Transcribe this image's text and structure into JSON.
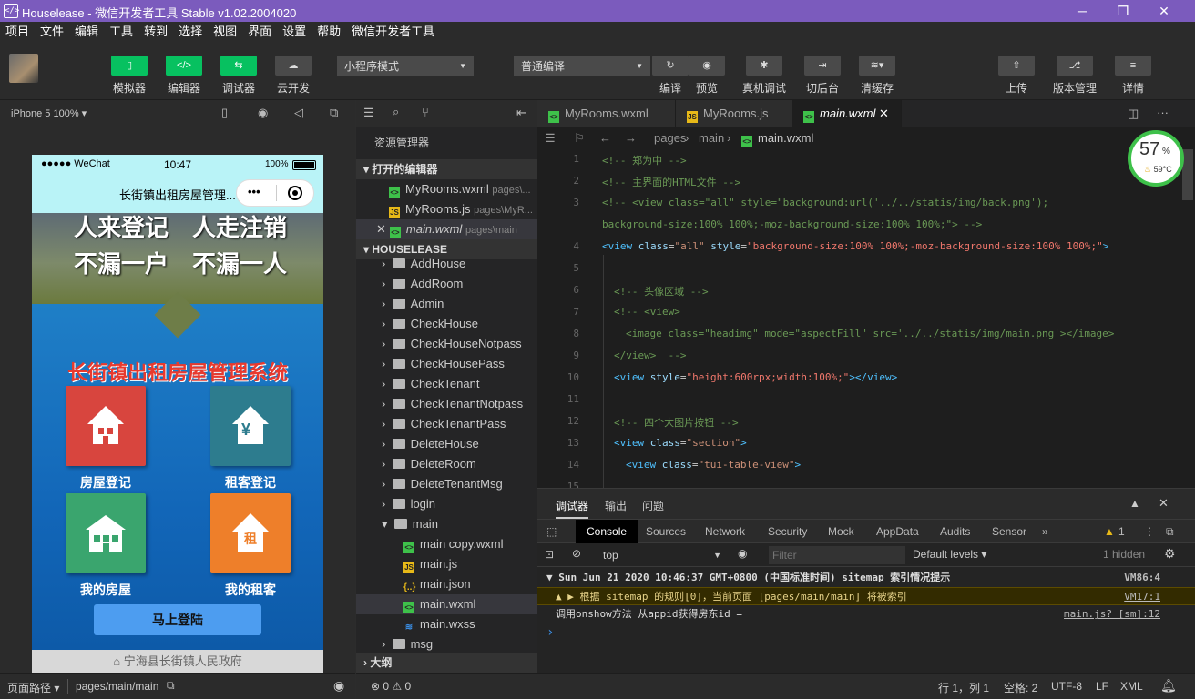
{
  "window": {
    "title": "Houselease - 微信开发者工具 Stable v1.02.2004020",
    "minimize": "─",
    "maximize": "❐",
    "close": "✕"
  },
  "menu": [
    "项目",
    "文件",
    "编辑",
    "工具",
    "转到",
    "选择",
    "视图",
    "界面",
    "设置",
    "帮助",
    "微信开发者工具"
  ],
  "toolbar": {
    "left_buttons": [
      {
        "label": "模拟器"
      },
      {
        "label": "编辑器"
      },
      {
        "label": "调试器"
      },
      {
        "label": "云开发"
      }
    ],
    "mode_select": "小程序模式",
    "compile_select": "普通编译",
    "compile_label": "编译",
    "preview_label": "预览",
    "remote_debug_label": "真机调试",
    "background_label": "切后台",
    "clear_cache_label": "清缓存",
    "upload_label": "上传",
    "version_label": "版本管理",
    "detail_label": "详情"
  },
  "simulator": {
    "device": "iPhone 5 100%",
    "status": {
      "signal": "●●●●● WeChat",
      "time": "10:47",
      "battery": "100%"
    },
    "nav_title": "长街镇出租房屋管理...",
    "hero_line1_a": "人来登记",
    "hero_line1_b": "人走注销",
    "hero_line2_a": "不漏一户",
    "hero_line2_b": "不漏一人",
    "system_title": "长街镇出租房屋管理系统",
    "tiles": [
      {
        "label": "房屋登记",
        "color": "#d8453e"
      },
      {
        "label": "租客登记",
        "color": "#2d7c8e"
      },
      {
        "label": "我的房屋",
        "color": "#3aa56e"
      },
      {
        "label": "我的租客",
        "color": "#ee7f2a"
      }
    ],
    "tile_rent_char": "租",
    "tile_yen_char": "¥",
    "login_button": "马上登陆",
    "footer_text": "宁海县长街镇人民政府",
    "path_label": "页面路径",
    "path_value": "pages/main/main"
  },
  "explorer": {
    "title": "资源管理器",
    "open_editors_label": "打开的编辑器",
    "open_editors": [
      {
        "name": "MyRooms.wxml",
        "path": "pages\\..."
      },
      {
        "name": "MyRooms.js",
        "path": "pages\\MyR..."
      },
      {
        "name": "main.wxml",
        "path": "pages\\main"
      }
    ],
    "project_label": "HOUSELEASE",
    "folders": [
      "AddHouse",
      "AddRoom",
      "Admin",
      "CheckHouse",
      "CheckHouseNotpass",
      "CheckHousePass",
      "CheckTenant",
      "CheckTenantNotpass",
      "CheckTenantPass",
      "DeleteHouse",
      "DeleteRoom",
      "DeleteTenantMsg",
      "login"
    ],
    "main_folder": "main",
    "main_files": [
      {
        "name": "main copy.wxml",
        "type": "wxml"
      },
      {
        "name": "main.js",
        "type": "js"
      },
      {
        "name": "main.json",
        "type": "json"
      },
      {
        "name": "main.wxml",
        "type": "wxml"
      },
      {
        "name": "main.wxss",
        "type": "wxss"
      }
    ],
    "msg_folder": "msg",
    "outline_label": "大纲",
    "problems": "⊗ 0 ⚠ 0"
  },
  "editor": {
    "tabs": [
      "MyRooms.wxml",
      "MyRooms.js",
      "main.wxml"
    ],
    "breadcrumb": [
      "pages",
      "main",
      "main.wxml"
    ],
    "gauge_percent": "57",
    "gauge_unit": "%",
    "gauge_temp": "59°C",
    "line_numbers": [
      "1",
      "2",
      "3",
      "",
      "4",
      "5",
      "6",
      "7",
      "8",
      "9",
      "10",
      "11",
      "12",
      "13",
      "14",
      "15"
    ]
  },
  "console": {
    "panel_tabs": [
      "调试器",
      "输出",
      "问题"
    ],
    "devtools_tabs": [
      "Console",
      "Sources",
      "Network",
      "Security",
      "Mock",
      "AppData",
      "Audits",
      "Sensor"
    ],
    "warn_count": "1",
    "context": "top",
    "filter_placeholder": "Filter",
    "levels": "Default levels",
    "hidden": "1 hidden",
    "logs": [
      {
        "text": "▼ Sun Jun 21 2020 10:46:37 GMT+0800 (中国标准时间) sitemap 索引情况提示",
        "link": "VM86:4"
      },
      {
        "text": "▲  ▶ 根据 sitemap 的规则[0]，当前页面 [pages/main/main] 将被索引",
        "link": "VM17:1"
      },
      {
        "text": "  调用onshow方法 从appid获得房东id =",
        "link": "main.js? [sm]:12"
      }
    ],
    "prompt": "›"
  },
  "statusbar": {
    "position": "行 1，列 1",
    "spaces": "空格: 2",
    "encoding": "UTF-8",
    "eol": "LF",
    "language": "XML"
  }
}
